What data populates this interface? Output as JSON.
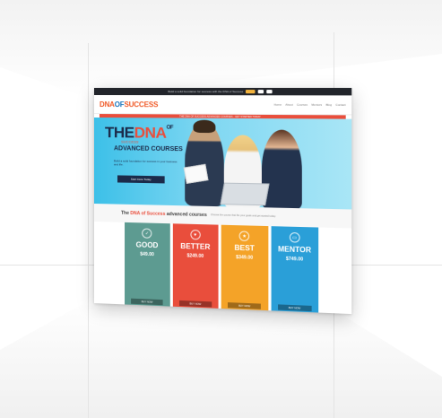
{
  "topbar": {
    "text": "Build a solid foundation for success with the DNA of Success"
  },
  "brand": {
    "part1": "DNA",
    "part2": "OF",
    "part3": "SUCCESS"
  },
  "nav": {
    "links": [
      "Home",
      "About",
      "Courses",
      "Mentors",
      "Blog",
      "Contact"
    ]
  },
  "redbar": {
    "text": "THE DNA OF SUCCESS ADVANCED COURSES - GET STARTED TODAY"
  },
  "hero": {
    "title_dna": "DNA",
    "title_the": "THE",
    "title_of": "OF",
    "subtitle": "SUCCESS",
    "headline": "ADVANCED COURSES",
    "description": "Build a solid foundation for success in your business and life.",
    "cta": "Start Here Today"
  },
  "intro": {
    "title_prefix": "The ",
    "title_highlight": "DNA of Success",
    "title_suffix": " advanced courses",
    "subtitle": "Choose the course that fits your goals and get started today."
  },
  "plans": [
    {
      "name": "GOOD",
      "icon": "✓",
      "price": "$49.00",
      "button": "BUY NOW",
      "color": "#5d9b91"
    },
    {
      "name": "BETTER",
      "icon": "♥",
      "price": "$249.00",
      "button": "BUY NOW",
      "color": "#e94e3c"
    },
    {
      "name": "BEST",
      "icon": "★",
      "price": "$349.00",
      "button": "BUY NOW",
      "color": "#f4a328"
    },
    {
      "name": "MENTOR",
      "icon": "▭",
      "price": "$749.00",
      "button": "BUY NOW",
      "color": "#2a9fd8"
    }
  ]
}
